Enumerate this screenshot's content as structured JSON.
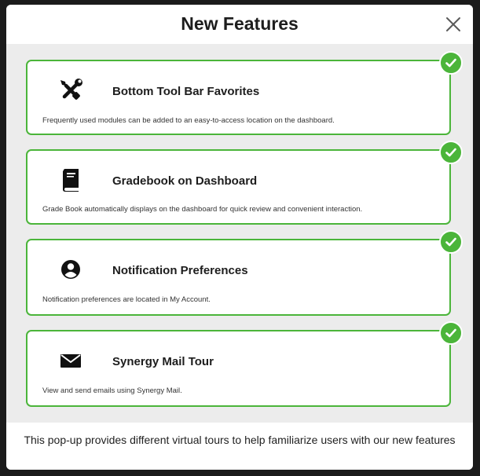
{
  "modal": {
    "title": "New Features",
    "close_icon": "close-icon",
    "footer_text": "This pop-up provides different virtual tours to help familiarize users with our new features"
  },
  "colors": {
    "accent_green": "#4bb53a",
    "background": "#ececec",
    "card_background": "#ffffff"
  },
  "features": [
    {
      "title": "Bottom Tool Bar Favorites",
      "description": "Frequently used modules can be added to an easy-to-access location on the dashboard.",
      "icon": "tools-icon",
      "completed": true
    },
    {
      "title": "Gradebook on Dashboard",
      "description": "Grade Book automatically displays on the dashboard for quick review and convenient interaction.",
      "icon": "book-icon",
      "completed": true
    },
    {
      "title": "Notification Preferences",
      "description": "Notification preferences are located in My Account.",
      "icon": "account-circle-icon",
      "completed": true
    },
    {
      "title": "Synergy Mail Tour",
      "description": "View and send emails using Synergy Mail.",
      "icon": "mail-icon",
      "completed": true
    }
  ]
}
